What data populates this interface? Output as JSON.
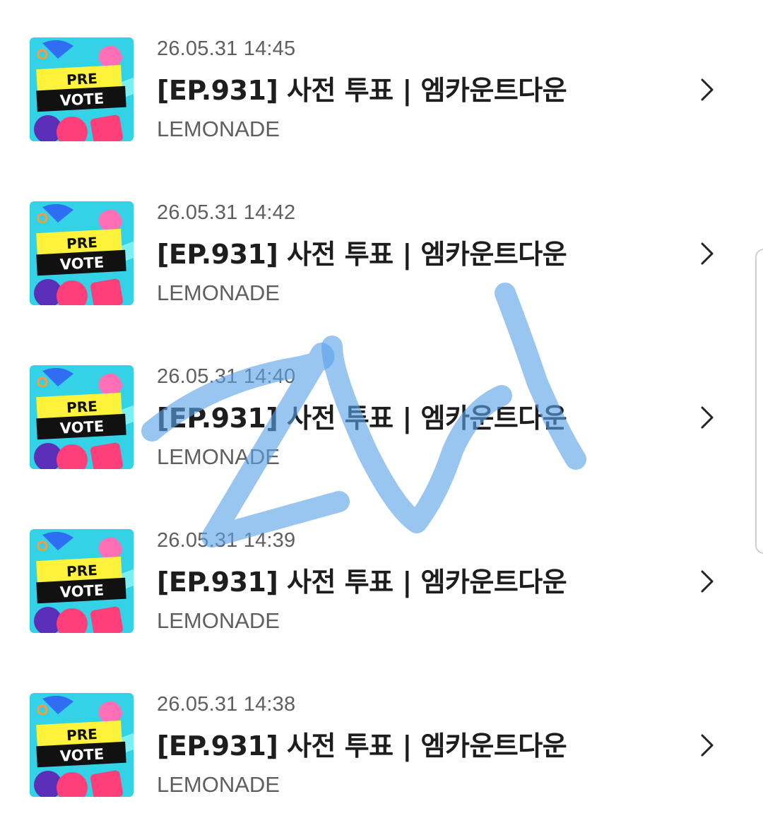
{
  "items": [
    {
      "date": "26.05.31 14:45",
      "title": "[EP.931] 사전 투표 | 엠카운트다운",
      "artist": "LEMONADE",
      "thumb_top": "PRE",
      "thumb_bottom": "VOTE"
    },
    {
      "date": "26.05.31 14:42",
      "title": "[EP.931] 사전 투표 | 엠카운트다운",
      "artist": "LEMONADE",
      "thumb_top": "PRE",
      "thumb_bottom": "VOTE"
    },
    {
      "date": "26.05.31 14:40",
      "title": "[EP.931] 사전 투표 | 엠카운트다운",
      "artist": "LEMONADE",
      "thumb_top": "PRE",
      "thumb_bottom": "VOTE"
    },
    {
      "date": "26.05.31 14:39",
      "title": "[EP.931] 사전 투표 | 엠카운트다운",
      "artist": "LEMONADE",
      "thumb_top": "PRE",
      "thumb_bottom": "VOTE"
    },
    {
      "date": "26.05.31 14:38",
      "title": "[EP.931] 사전 투표 | 엠카운트다운",
      "artist": "LEMONADE",
      "thumb_top": "PRE",
      "thumb_bottom": "VOTE"
    }
  ],
  "icons": {
    "chevron": "chevron-right-icon"
  },
  "colors": {
    "thumb_bg": "#33d2e6",
    "thumb_banner": "#fff23a",
    "thumb_text_bg": "#111111",
    "watermark": "#5aa2e8"
  }
}
